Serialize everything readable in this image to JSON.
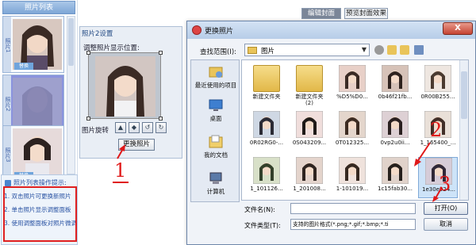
{
  "left_panel": {
    "title": "照片列表",
    "items": [
      {
        "label": "照片1",
        "badge": "替换"
      },
      {
        "label": "照片2",
        "badge": ""
      },
      {
        "label": "照片3",
        "badge": "替换"
      }
    ],
    "tips": {
      "title": "照片列表操作提示:",
      "lines": [
        "1. 双击照片可更换新照片",
        "2. 单击照片显示调整面板",
        "3. 使用调整面板对照片微调"
      ]
    }
  },
  "settings": {
    "title": "照片2设置",
    "position_label": "调整照片显示位置:",
    "rotate_label": "图片旋转",
    "rotate_buttons": [
      "▲",
      "◆",
      "↺",
      "↻"
    ],
    "replace_button": "更换照片"
  },
  "top_tabs": [
    "编辑封面",
    "预览封面效果"
  ],
  "annotations": [
    "1",
    "2",
    "3"
  ],
  "dialog": {
    "title": "更换照片",
    "close": "X",
    "look_in_label": "查找范围(I):",
    "look_in_value": "图片",
    "places": [
      "最近使用的项目",
      "桌面",
      "我的文档",
      "计算机"
    ],
    "files": [
      {
        "name": "新建文件夹",
        "type": "folder"
      },
      {
        "name": "新建文件夹\n(2)",
        "type": "folder"
      },
      {
        "name": "%D5%D0...",
        "type": "photo"
      },
      {
        "name": "0b46f21fb...",
        "type": "photo"
      },
      {
        "name": "0R00B255...",
        "type": "photo"
      },
      {
        "name": "0R02RG0-...",
        "type": "photo"
      },
      {
        "name": "0S043209...",
        "type": "photo"
      },
      {
        "name": "0T012325...",
        "type": "photo"
      },
      {
        "name": "0vp2u0ii...",
        "type": "photo"
      },
      {
        "name": "1_165400_...",
        "type": "photo"
      },
      {
        "name": "1_101126...",
        "type": "photo"
      },
      {
        "name": "1_201008...",
        "type": "photo"
      },
      {
        "name": "1-101019...",
        "type": "photo"
      },
      {
        "name": "1c15fab30...",
        "type": "photo"
      },
      {
        "name": "1e30e924...",
        "type": "photo"
      }
    ],
    "filename_label": "文件名(N):",
    "filename_value": "",
    "filetype_label": "文件类型(T):",
    "filetype_value": "支持的图片格式(*.png;*.gif;*.bmp;*.ti",
    "open_button": "打开(O)",
    "cancel_button": "取消"
  },
  "colors": {
    "annotation": "#e01919",
    "accent": "#7ea6d6"
  }
}
